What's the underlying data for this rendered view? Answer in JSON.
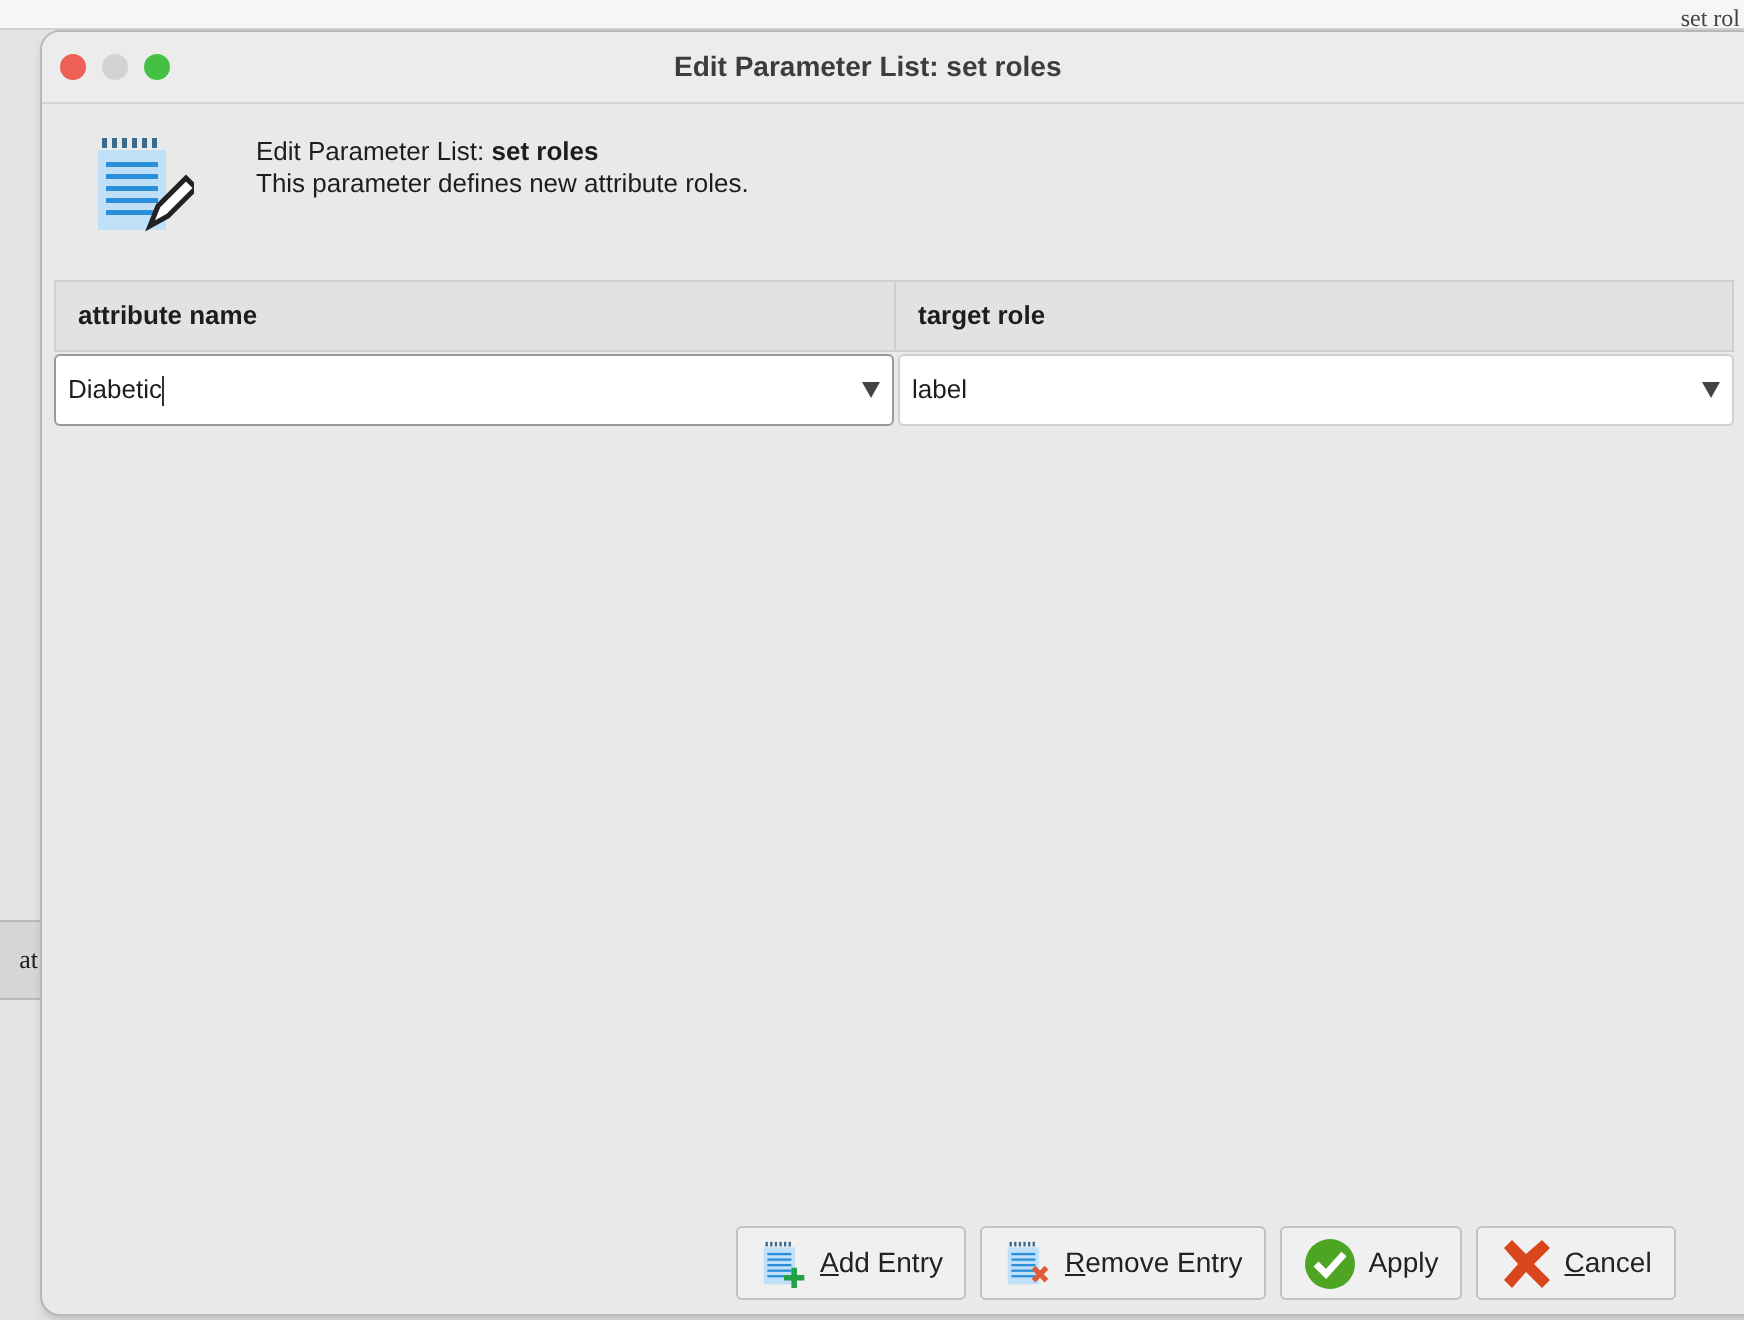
{
  "background": {
    "top_right_text": "set rol",
    "left_text": "at"
  },
  "window": {
    "title": "Edit Parameter List: set roles"
  },
  "header": {
    "prefix": "Edit Parameter List:",
    "name": "set roles",
    "description": "This parameter defines new attribute roles."
  },
  "table": {
    "columns": [
      "attribute name",
      "target role"
    ],
    "rows": [
      [
        "Diabetic",
        "label"
      ]
    ]
  },
  "buttons": [
    {
      "kind": "add",
      "mnemonic": "A",
      "rest": "dd Entry"
    },
    {
      "kind": "remove",
      "mnemonic": "R",
      "rest": "emove Entry"
    },
    {
      "kind": "apply",
      "rest": "Apply"
    },
    {
      "kind": "cancel",
      "mnemonic": "C",
      "rest": "ancel"
    }
  ]
}
